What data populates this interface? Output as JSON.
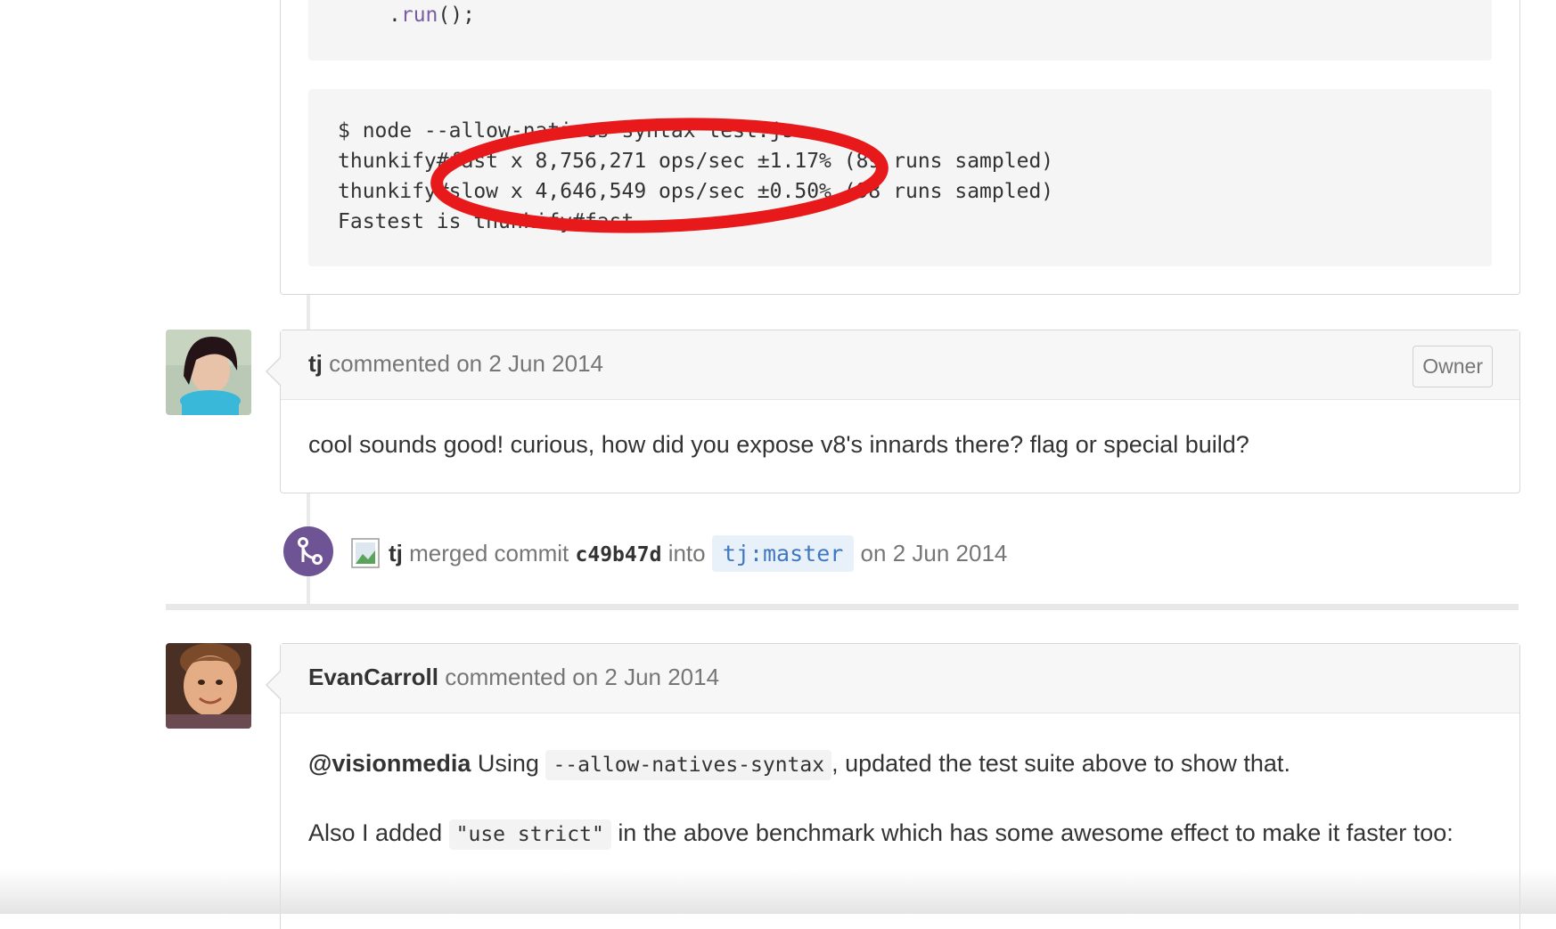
{
  "top_comment": {
    "code_line_run": [
      ".",
      "run",
      "();"
    ],
    "output_lines": [
      "$ node --allow-natives-syntax test.js",
      "thunkify#fast x 8,756,271 ops/sec ±1.17% (89 runs sampled)",
      "thunkify#slow x 4,646,549 ops/sec ±0.50% (98 runs sampled)",
      "Fastest is thunkify#fast"
    ]
  },
  "comment_tj": {
    "author": "tj",
    "action": "commented on 2 Jun 2014",
    "badge": "Owner",
    "body": "cool sounds good! curious, how did you expose v8's innards there? flag or special build?"
  },
  "merge_event": {
    "user": "tj",
    "action": "merged commit",
    "commit": "c49b47d",
    "into": "into",
    "branch": "tj:master",
    "date": "on 2 Jun 2014"
  },
  "comment_evan": {
    "author": "EvanCarroll",
    "action": "commented on 2 Jun 2014",
    "mention": "@visionmedia",
    "p1_before": "Using",
    "p1_code": "--allow-natives-syntax",
    "p1_after": ", updated the test suite above to show that.",
    "p2_before": "Also I added",
    "p2_code": "\"use strict\"",
    "p2_after": "in the above benchmark which has some awesome effect to make it faster too:"
  },
  "colors": {
    "annotation": "#e8191b",
    "merge": "#6e5494",
    "branch_text": "#4078c0"
  }
}
